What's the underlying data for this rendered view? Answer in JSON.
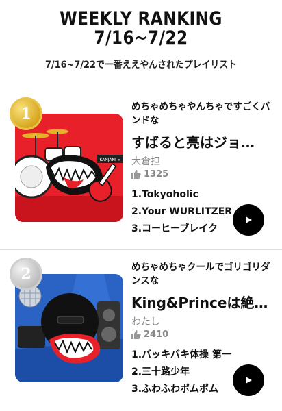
{
  "header": {
    "title_line1": "WEEKLY RANKING",
    "title_line2": "7/16~7/22",
    "subtitle": "7/16~7/22で一番ええやんされたプレイリスト"
  },
  "rankings": [
    {
      "rank": "1",
      "medal": "gold",
      "description": "めちゃめちゃやんちゃですごくバンドな",
      "title": "すばると亮はジョ…",
      "author": "大倉担",
      "likes": "1325",
      "songs": [
        "1.Tokyoholic",
        "2.Your WURLITZER",
        "3.コーヒーブレイク"
      ],
      "thumb_label": "KANJANI ∞"
    },
    {
      "rank": "2",
      "medal": "silver",
      "description": "めちゃめちゃクールでゴリゴリダンスな",
      "title": "King&Princeは絶…",
      "author": "わたし",
      "likes": "2410",
      "songs": [
        "1.バッキバキ体操 第一",
        "2.三十路少年",
        "3.ふわふわポムポム"
      ]
    }
  ],
  "icons": {
    "like": "thumbs-up-icon",
    "play": "play-icon"
  },
  "colors": {
    "accent": "#000000",
    "card1_bg": "#e8202a",
    "card2_bg": "#2a63c4"
  }
}
